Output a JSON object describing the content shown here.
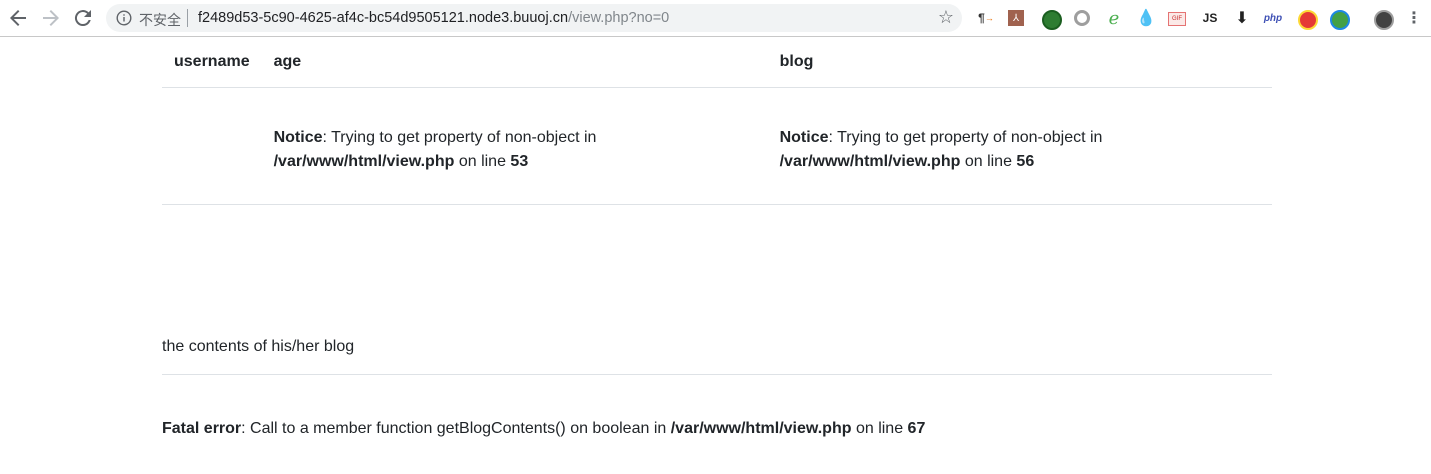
{
  "browser": {
    "security_label": "不安全",
    "url_host": "f2489d53-5c90-4625-af4c-bc54d9505121.node3.buuoj.cn",
    "url_path": "/view.php?no=0",
    "extensions": [
      "paragraph-icon",
      "pdf-icon",
      "green-ext-icon",
      "ring-icon",
      "e-icon",
      "drop-icon",
      "gif-icon",
      "js-icon",
      "download-icon",
      "php-icon",
      "red-ext-icon",
      "globe-ext-icon",
      "avatar-icon",
      "menu-icon"
    ],
    "ext_text": {
      "js": "JS",
      "php": "php"
    }
  },
  "table": {
    "headers": [
      "username",
      "age",
      "blog"
    ],
    "notice_age": {
      "label": "Notice",
      "msg": ": Trying to get property of non-object in",
      "file": "/var/www/html/view.php",
      "online": " on line ",
      "line": "53"
    },
    "notice_blog": {
      "label": "Notice",
      "msg": ": Trying to get property of non-object in",
      "file": "/var/www/html/view.php",
      "online": " on line ",
      "line": "56"
    }
  },
  "blog_contents": "the contents of his/her blog",
  "fatal": {
    "label": "Fatal error",
    "msg": ": Call to a member function getBlogContents() on boolean in ",
    "file": "/var/www/html/view.php",
    "online": " on line ",
    "line": "67"
  }
}
